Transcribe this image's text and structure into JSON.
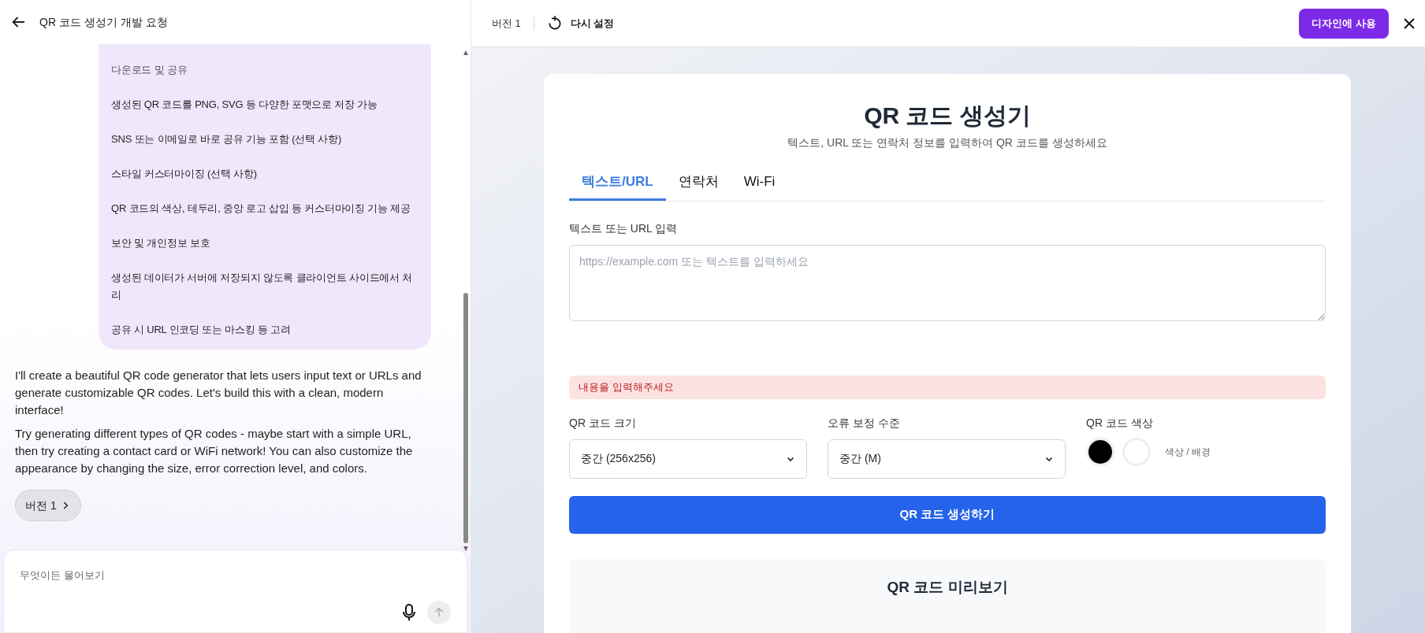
{
  "chat": {
    "title": "QR 코드 생성기 개발 요청",
    "request_items": [
      "다운로드 및 공유",
      "생성된 QR 코드를 PNG, SVG 등 다양한 포맷으로 저장 가능",
      "SNS 또는 이메일로 바로 공유 기능 포함 (선택 사항)",
      "스타일 커스터마이징 (선택 사항)",
      "QR 코드의 색상, 테두리, 중앙 로고 삽입 등 커스터마이징 기능 제공",
      "보안 및 개인정보 보호",
      "생성된 데이터가 서버에 저장되지 않도록 클라이언트 사이드에서 처리",
      "공유 시 URL 인코딩 또는 마스킹 등 고려"
    ],
    "reply_paragraphs": [
      "I'll create a beautiful QR code generator that lets users input text or URLs and generate customizable QR codes. Let's build this with a clean, modern interface!",
      "Try generating different types of QR codes - maybe start with a simple URL, then try creating a contact card or WiFi network! You can also customize the appearance by changing the size, error correction level, and colors."
    ],
    "version_chip": "버전 1",
    "input": {
      "placeholder": "무엇이든 물어보기"
    }
  },
  "preview_header": {
    "version": "버전 1",
    "reset": "다시 설정",
    "use_button": "디자인에 사용"
  },
  "app": {
    "title": "QR 코드 생성기",
    "subtitle": "텍스트, URL 또는 연락처 정보를 입력하여 QR 코드를 생성하세요",
    "tabs": [
      {
        "label": "텍스트/URL",
        "selected": true
      },
      {
        "label": "연락처",
        "selected": false
      },
      {
        "label": "Wi-Fi",
        "selected": false
      }
    ],
    "text_label": "텍스트 또는 URL 입력",
    "text_placeholder": "https://example.com 또는 텍스트를 입력하세요",
    "error": "내용을 입력해주세요",
    "selects": [
      {
        "label": "QR 코드 크기",
        "value": "중간 (256x256)"
      },
      {
        "label": "오류 보정 수준",
        "value": "중간 (M)"
      }
    ],
    "color_label": "QR 코드 색상",
    "colors": [
      {
        "color": "#000000"
      },
      {
        "color": "#ffffff"
      }
    ],
    "color_hint": "색상 / 배경",
    "generate_button": "QR 코드 생성하기",
    "preview_title": "QR 코드 미리보기"
  }
}
